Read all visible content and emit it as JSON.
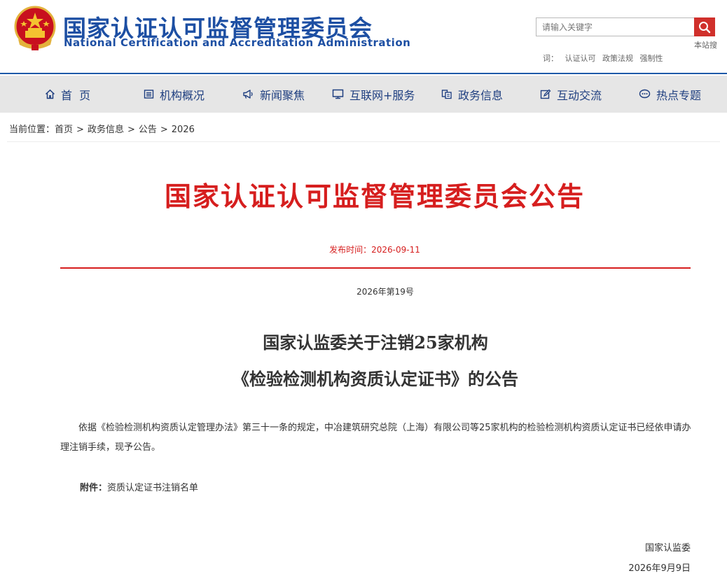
{
  "header": {
    "title": "国家认证认可监督管理委员会",
    "subtitle": "National Certification and Accreditation Administration",
    "search_placeholder": "请输入关键字",
    "site_search_label": "本站搜",
    "hot_words_label": "词：",
    "hot_words": [
      "认证认可",
      "政策法规",
      "强制性"
    ]
  },
  "nav": {
    "items": [
      {
        "label": "首  页",
        "icon": "home-icon"
      },
      {
        "label": "机构概况",
        "icon": "list-icon"
      },
      {
        "label": "新闻聚焦",
        "icon": "megaphone-icon"
      },
      {
        "label": "互联网+服务",
        "icon": "monitor-icon"
      },
      {
        "label": "政务信息",
        "icon": "document-icon"
      },
      {
        "label": "互动交流",
        "icon": "edit-icon"
      },
      {
        "label": "热点专题",
        "icon": "chat-icon"
      }
    ]
  },
  "breadcrumb": {
    "label": "当前位置：",
    "items": [
      "首页",
      "政务信息",
      "公告",
      "2026"
    ],
    "separator": ">"
  },
  "article": {
    "title": "国家认证认可监督管理委员会公告",
    "publish_time": "发布时间：2026-09-11",
    "doc_number": "2026年第19号",
    "doc_title_line1": "国家认监委关于注销25家机构",
    "doc_title_line2": "《检验检测机构资质认定证书》的公告",
    "body": "依据《检验检测机构资质认定管理办法》第三十一条的规定，中冶建筑研究总院（上海）有限公司等25家机构的检验检测机构资质认定证书已经依申请办理注销手续，现予公告。",
    "attachment_label": "附件：",
    "attachment_name": "资质认定证书注销名单",
    "signer": "国家认监委",
    "sign_date": "2026年9月9日"
  },
  "colors": {
    "brand_blue": "#1d4fa3",
    "accent_red": "#d61e1e",
    "nav_bg": "#e6e6e6"
  }
}
